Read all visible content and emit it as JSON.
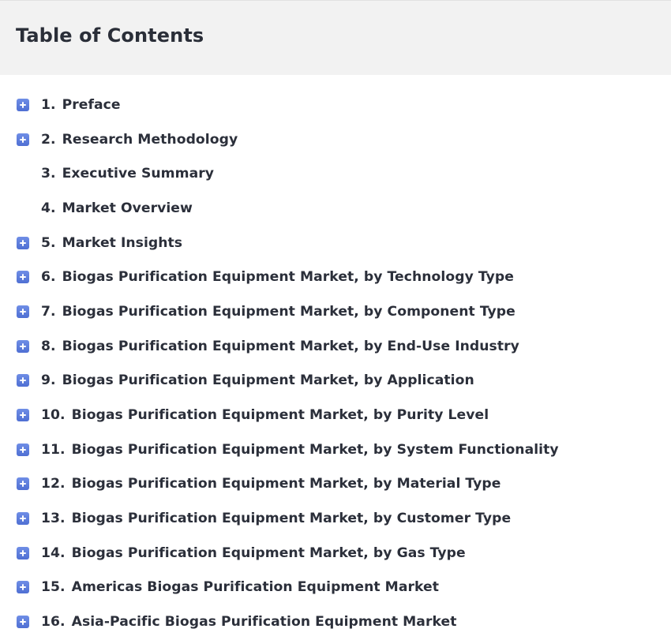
{
  "header": {
    "title": "Table of Contents"
  },
  "toc": {
    "items": [
      {
        "number": "1.",
        "label": "Preface",
        "expandable": true
      },
      {
        "number": "2.",
        "label": "Research Methodology",
        "expandable": true
      },
      {
        "number": "3.",
        "label": "Executive Summary",
        "expandable": false
      },
      {
        "number": "4.",
        "label": "Market Overview",
        "expandable": false
      },
      {
        "number": "5.",
        "label": "Market Insights",
        "expandable": true
      },
      {
        "number": "6.",
        "label": "Biogas Purification Equipment Market, by Technology Type",
        "expandable": true
      },
      {
        "number": "7.",
        "label": "Biogas Purification Equipment Market, by Component Type",
        "expandable": true
      },
      {
        "number": "8.",
        "label": "Biogas Purification Equipment Market, by End-Use Industry",
        "expandable": true
      },
      {
        "number": "9.",
        "label": "Biogas Purification Equipment Market, by Application",
        "expandable": true
      },
      {
        "number": "10.",
        "label": "Biogas Purification Equipment Market, by Purity Level",
        "expandable": true
      },
      {
        "number": "11.",
        "label": "Biogas Purification Equipment Market, by System Functionality",
        "expandable": true
      },
      {
        "number": "12.",
        "label": "Biogas Purification Equipment Market, by Material Type",
        "expandable": true
      },
      {
        "number": "13.",
        "label": "Biogas Purification Equipment Market, by Customer Type",
        "expandable": true
      },
      {
        "number": "14.",
        "label": "Biogas Purification Equipment Market, by Gas Type",
        "expandable": true
      },
      {
        "number": "15.",
        "label": "Americas Biogas Purification Equipment Market",
        "expandable": true
      },
      {
        "number": "16.",
        "label": "Asia-Pacific Biogas Purification Equipment Market",
        "expandable": true
      }
    ]
  },
  "icons": {
    "expand": "plus-square-icon"
  },
  "colors": {
    "header_background": "#f2f2f2",
    "icon_accent": "#5b7bdc",
    "text": "#2b2f3a"
  }
}
